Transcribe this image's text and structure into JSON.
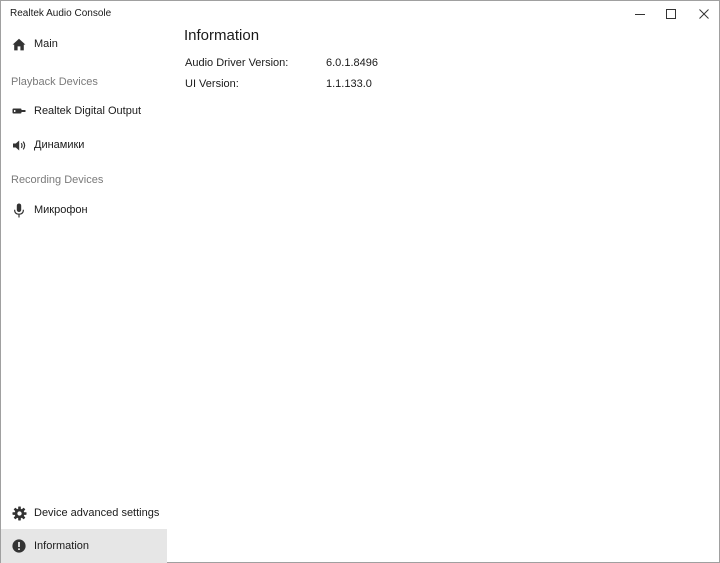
{
  "window": {
    "title": "Realtek Audio Console",
    "controls": {
      "minimize_icon": "minimize-icon",
      "maximize_icon": "maximize-icon",
      "close_icon": "close-icon"
    }
  },
  "sidebar": {
    "main": {
      "label": "Main",
      "icon": "home-icon"
    },
    "playback_header": "Playback Devices",
    "playback_devices": [
      {
        "label": "Realtek Digital Output",
        "icon": "digital-output-icon"
      },
      {
        "label": "Динамики",
        "icon": "speaker-icon"
      }
    ],
    "recording_header": "Recording Devices",
    "recording_devices": [
      {
        "label": "Микрофон",
        "icon": "microphone-icon"
      }
    ],
    "bottom": [
      {
        "label": "Device advanced settings",
        "icon": "gear-icon"
      },
      {
        "label": "Information",
        "icon": "info-icon",
        "selected": true
      }
    ]
  },
  "main": {
    "title": "Information",
    "rows": [
      {
        "label": "Audio Driver Version:",
        "value": "6.0.1.8496"
      },
      {
        "label": "UI Version:",
        "value": "1.1.133.0"
      }
    ]
  },
  "colors": {
    "selected_background": "#e6e6e6",
    "section_header": "#7a7a7a",
    "text": "#1a1a1a",
    "icon": "#333333"
  }
}
